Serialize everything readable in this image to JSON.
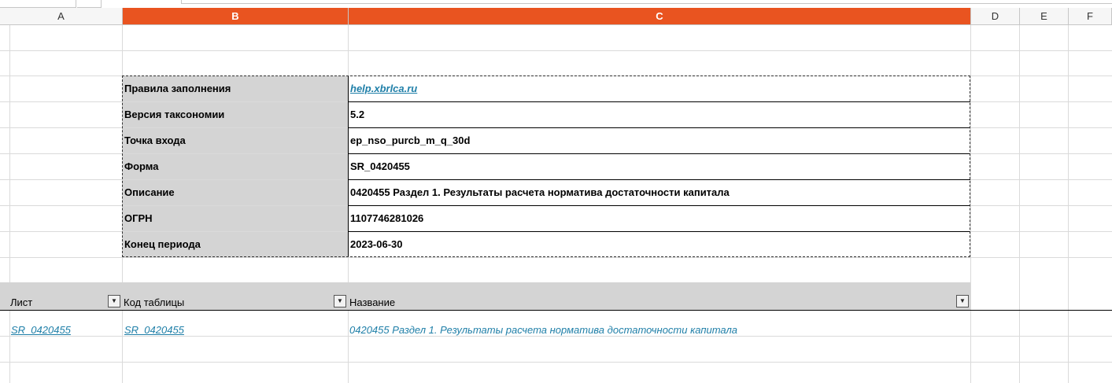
{
  "columns": [
    "A",
    "B",
    "C",
    "D",
    "E",
    "F"
  ],
  "selected_columns": [
    "B",
    "C"
  ],
  "info": [
    {
      "label": "Правила заполнения",
      "value": "help.xbrlca.ru",
      "is_link": true
    },
    {
      "label": "Версия таксономии",
      "value": "5.2",
      "is_link": false
    },
    {
      "label": "Точка входа",
      "value": "ep_nso_purcb_m_q_30d",
      "is_link": false
    },
    {
      "label": "Форма",
      "value": "SR_0420455",
      "is_link": false
    },
    {
      "label": "Описание",
      "value": "0420455  Раздел 1. Результаты расчета норматива достаточности капитала",
      "is_link": false
    },
    {
      "label": "ОГРН",
      "value": "1107746281026",
      "is_link": false
    },
    {
      "label": "Конец периода",
      "value": "2023-06-30",
      "is_link": false
    }
  ],
  "table": {
    "headers": [
      "Лист",
      "Код таблицы",
      "Название"
    ],
    "filter_icon": "dropdown-arrow-icon",
    "rows": [
      {
        "sheet": "SR_0420455",
        "code": "SR_0420455",
        "name": "0420455  Раздел 1. Результаты расчета норматива достаточности капитала"
      }
    ]
  },
  "colors": {
    "selected_header": "#e95420",
    "label_bg": "#d4d4d4",
    "link": "#1f7fa8"
  }
}
